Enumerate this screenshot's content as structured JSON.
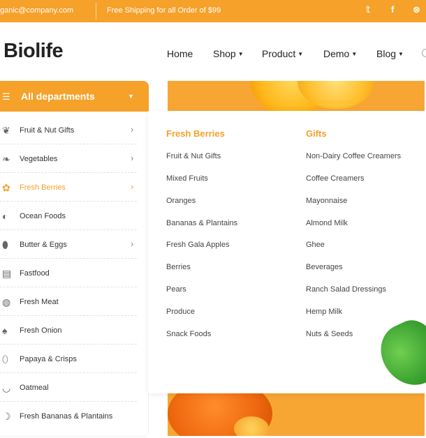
{
  "topbar": {
    "email": "ganic@company.com",
    "shipping": "Free Shipping for all Order of $99",
    "social": [
      "twitter-icon",
      "facebook-icon",
      "pinterest-icon"
    ],
    "social_glyphs": [
      "𝕥",
      "f",
      "⊗"
    ]
  },
  "header": {
    "logo": "Biolife",
    "nav": [
      {
        "label": "Home",
        "dropdown": false
      },
      {
        "label": "Shop",
        "dropdown": true
      },
      {
        "label": "Product",
        "dropdown": true
      },
      {
        "label": "Demo",
        "dropdown": true
      },
      {
        "label": "Blog",
        "dropdown": true
      }
    ]
  },
  "departments": {
    "title": "All departments",
    "items": [
      {
        "label": "Fruit & Nut Gifts",
        "icon": "gift-basket-icon",
        "arrow": true
      },
      {
        "label": "Vegetables",
        "icon": "carrot-icon",
        "arrow": true
      },
      {
        "label": "Fresh Berries",
        "icon": "berries-icon",
        "arrow": true,
        "active": true
      },
      {
        "label": "Ocean Foods",
        "icon": "fish-icon",
        "arrow": false
      },
      {
        "label": "Butter & Eggs",
        "icon": "egg-icon",
        "arrow": true
      },
      {
        "label": "Fastfood",
        "icon": "fastfood-icon",
        "arrow": false
      },
      {
        "label": "Fresh Meat",
        "icon": "meat-icon",
        "arrow": false
      },
      {
        "label": "Fresh Onion",
        "icon": "onion-icon",
        "arrow": false
      },
      {
        "label": "Papaya & Crisps",
        "icon": "papaya-icon",
        "arrow": false
      },
      {
        "label": "Oatmeal",
        "icon": "oatmeal-icon",
        "arrow": false
      },
      {
        "label": "Fresh Bananas & Plantains",
        "icon": "banana-icon",
        "arrow": false
      }
    ]
  },
  "mega_menu": {
    "columns": [
      {
        "title": "Fresh Berries",
        "items": [
          "Fruit & Nut Gifts",
          "Mixed Fruits",
          "Oranges",
          "Bananas & Plantains",
          "Fresh Gala Apples",
          "Berries",
          "Pears",
          "Produce",
          "Snack Foods"
        ]
      },
      {
        "title": "Gifts",
        "items": [
          "Non-Dairy Coffee Creamers",
          "Coffee Creamers",
          "Mayonnaise",
          "Almond Milk",
          "Ghee",
          "Beverages",
          "Ranch Salad Dressings",
          "Hemp Milk",
          "Nuts & Seeds"
        ]
      }
    ]
  },
  "colors": {
    "accent": "#f5a12a",
    "text": "#333333"
  }
}
